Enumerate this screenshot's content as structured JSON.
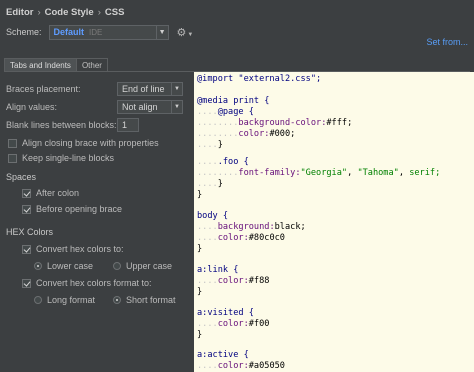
{
  "breadcrumb": [
    "Editor",
    "Code Style",
    "CSS"
  ],
  "scheme": {
    "label": "Scheme:",
    "value": "Default",
    "suffix": "IDE"
  },
  "set_from": "Set from...",
  "tabs": [
    {
      "label": "Tabs and Indents"
    },
    {
      "label": "Other"
    }
  ],
  "options": {
    "braces_placement": {
      "label": "Braces placement:",
      "value": "End of line"
    },
    "align_values": {
      "label": "Align values:",
      "value": "Not align"
    },
    "blank_lines": {
      "label": "Blank lines between blocks:",
      "value": "1"
    },
    "align_closing": {
      "label": "Align closing brace with properties",
      "checked": false
    },
    "keep_single": {
      "label": "Keep single-line blocks",
      "checked": false
    }
  },
  "spaces": {
    "title": "Spaces",
    "after_colon": {
      "label": "After colon",
      "checked": true
    },
    "before_brace": {
      "label": "Before opening brace",
      "checked": true
    }
  },
  "hex": {
    "title": "HEX Colors",
    "convert_to": {
      "label": "Convert hex colors to:",
      "checked": true
    },
    "lower": {
      "label": "Lower case",
      "selected": true
    },
    "upper": {
      "label": "Upper case",
      "selected": false
    },
    "convert_format": {
      "label": "Convert hex colors format to:",
      "checked": true
    },
    "long": {
      "label": "Long format",
      "selected": false
    },
    "short": {
      "label": "Short format",
      "selected": true
    }
  },
  "code": {
    "l1": "@import \"external2.css\";",
    "l2": "@media print {",
    "l3_sel": "@page {",
    "l4_prop": "background-color:",
    "l4_val": "#fff;",
    "l5_prop": "color:",
    "l5_val": "#000;",
    "l6": "}",
    "l7_sel": ".foo {",
    "l8_prop": "font-family:",
    "l8_val1": "\"Georgia\"",
    "l8_val2": "\"Tahoma\"",
    "l8_val3": "serif;",
    "l9": "}",
    "l10": "}",
    "l11": "body {",
    "l12_prop": "background:",
    "l12_val": "black;",
    "l13_prop": "color:",
    "l13_val": "#80c0c0",
    "l14": "}",
    "l15": "a:link {",
    "l16_prop": "color:",
    "l16_val": "#f88",
    "l17": "}",
    "l18": "a:visited {",
    "l19_prop": "color:",
    "l19_val": "#f00",
    "l20": "}",
    "l21": "a:active {",
    "l22_prop": "color:",
    "l22_val": "#a05050"
  }
}
